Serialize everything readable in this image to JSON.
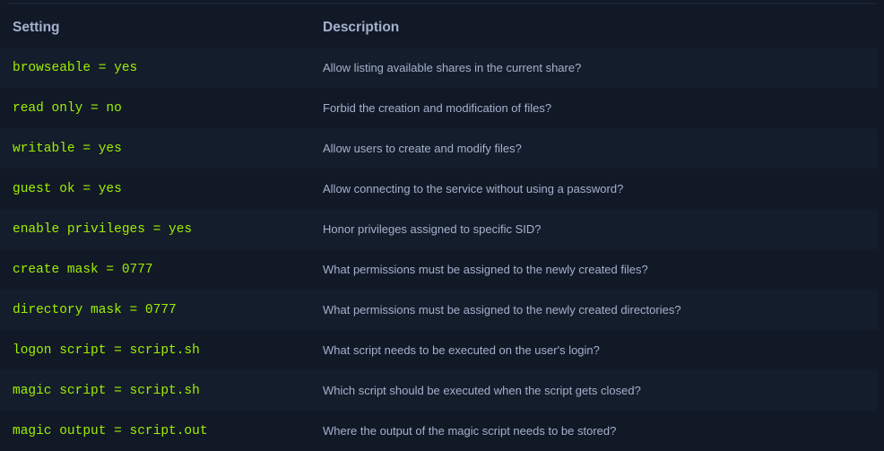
{
  "table": {
    "headers": [
      "Setting",
      "Description"
    ],
    "rows": [
      {
        "setting": "browseable = yes",
        "description": "Allow listing available shares in the current share?"
      },
      {
        "setting": "read only = no",
        "description": "Forbid the creation and modification of files?"
      },
      {
        "setting": "writable = yes",
        "description": "Allow users to create and modify files?"
      },
      {
        "setting": "guest ok = yes",
        "description": "Allow connecting to the service without using a password?"
      },
      {
        "setting": "enable privileges = yes",
        "description": "Honor privileges assigned to specific SID?"
      },
      {
        "setting": "create mask = 0777",
        "description": "What permissions must be assigned to the newly created files?"
      },
      {
        "setting": "directory mask = 0777",
        "description": "What permissions must be assigned to the newly created directories?"
      },
      {
        "setting": "logon script = script.sh",
        "description": "What script needs to be executed on the user's login?"
      },
      {
        "setting": "magic script = script.sh",
        "description": "Which script should be executed when the script gets closed?"
      },
      {
        "setting": "magic output = script.out",
        "description": "Where the output of the magic script needs to be stored?"
      }
    ]
  },
  "colors": {
    "background": "#111927",
    "stripe": "#141d2b",
    "setting_text": "#9fef00",
    "description_text": "#a4b1cd"
  }
}
